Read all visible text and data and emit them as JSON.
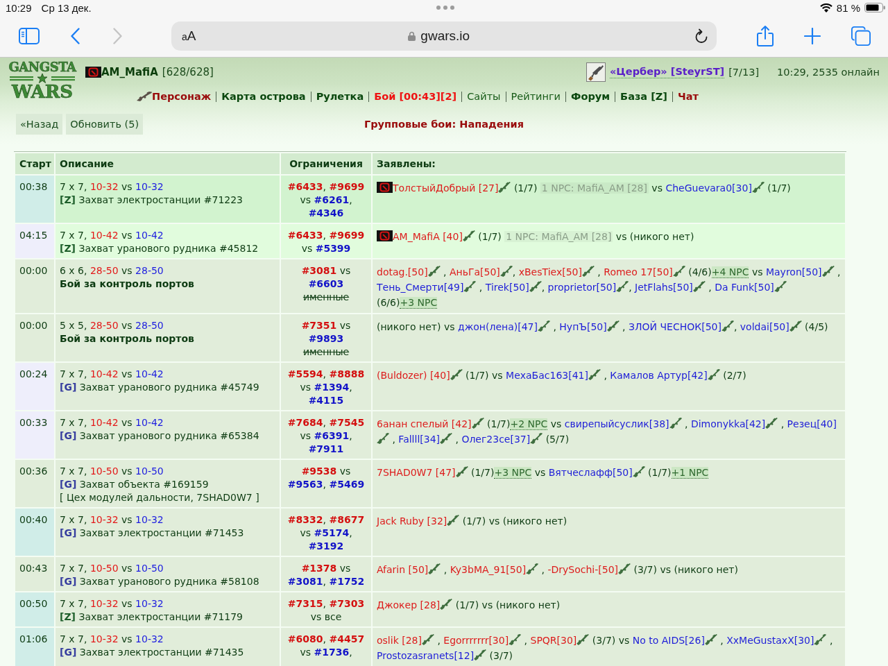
{
  "status_bar": {
    "time": "10:29",
    "date": "Ср 13 дек.",
    "battery": "81 %"
  },
  "browser": {
    "text_size": "aA",
    "address": "gwars.io",
    "back_disabled": false,
    "forward_disabled": true
  },
  "header": {
    "logo": {
      "top": "GANGSTA",
      "bottom": "WARS"
    },
    "player": {
      "name": "AM_MafiA",
      "hp": "[628/628]"
    },
    "weapon": {
      "name": "«Цербер» [SteyrST]",
      "count": "[7/13]"
    },
    "online": "10:29, 2535 онлайн",
    "nav": [
      {
        "label": "Персонаж",
        "kind": "accent"
      },
      {
        "label": "Карта острова",
        "kind": "bold"
      },
      {
        "label": "Рулетка",
        "kind": "bold"
      },
      {
        "label": "Бой [00:43][2]",
        "kind": "alert"
      },
      {
        "label": "Сайты",
        "kind": "plain"
      },
      {
        "label": "Рейтинги",
        "kind": "plain"
      },
      {
        "label": "Форум",
        "kind": "bold"
      },
      {
        "label": "База [Z]",
        "kind": "bold"
      },
      {
        "label": "Чат",
        "kind": "accent"
      }
    ]
  },
  "controls": {
    "buttons": [
      "«Назад",
      "Обновить (5)"
    ]
  },
  "title": "Групповые бои: Нападения",
  "table": {
    "columns": [
      "Старт",
      "Описание",
      "Ограничения",
      "Заявлены:"
    ],
    "rows": [
      {
        "start": "00:38",
        "color": "#d0ede8",
        "kind": "clan",
        "format": [
          {
            "text": "7 x 7, "
          },
          {
            "text": "10-32",
            "color": "#e31919"
          },
          {
            "text": " vs "
          },
          {
            "text": "10-32",
            "color": "#1d1de0"
          }
        ],
        "objective": {
          "tag": {
            "text": "[Z]",
            "color": "#1d5e2a"
          },
          "text": "Захват электростанции #71223",
          "bold": false
        },
        "limits": [
          {
            "text": "#6433",
            "color": "#d40f0f"
          },
          {
            "text": ", "
          },
          {
            "text": "#9699",
            "color": "#d40f0f"
          },
          {
            "text": " vs "
          },
          {
            "text": "#6261",
            "color": "#1212c8"
          },
          {
            "text": ", "
          },
          {
            "text": "#4346",
            "color": "#1212c8"
          }
        ],
        "entrants": [
          {
            "kind": "attacker",
            "name": "ТолстыйДобрый [27]",
            "clan": true,
            "after": " (1/7) "
          },
          {
            "kind": "npc",
            "text": "1 NPC: MafiA_AM [28]"
          },
          {
            "kind": "text",
            "text": " vs "
          },
          {
            "kind": "defender",
            "name": "CheGuevara0[30]",
            "clan": false,
            "after": " (1/7)"
          }
        ]
      },
      {
        "start": "04:15",
        "color": "#eeeefb",
        "kind": "own",
        "format": [
          {
            "text": "7 x 7, "
          },
          {
            "text": "10-42",
            "color": "#e31919"
          },
          {
            "text": " vs "
          },
          {
            "text": "10-42",
            "color": "#1d1de0"
          }
        ],
        "objective": {
          "tag": {
            "text": "[Z]",
            "color": "#1d5e2a"
          },
          "text": "Захват уранового рудника #45812",
          "bold": false
        },
        "limits": [
          {
            "text": "#6433",
            "color": "#d40f0f"
          },
          {
            "text": ", "
          },
          {
            "text": "#9699",
            "color": "#d40f0f"
          },
          {
            "text": " vs "
          },
          {
            "text": "#5399",
            "color": "#1212c8"
          }
        ],
        "entrants": [
          {
            "kind": "attacker",
            "name": "AM_MafiA [40]",
            "clan": true,
            "after": " (1/7) "
          },
          {
            "kind": "npc",
            "text": "1 NPC: MafiA_AM [28]"
          },
          {
            "kind": "text",
            "text": " vs (никого нет)"
          }
        ]
      },
      {
        "start": "00:00",
        "color": "#e1edda",
        "kind": "open",
        "format": [
          {
            "text": "6 x 6, "
          },
          {
            "text": "28-50",
            "color": "#e31919"
          },
          {
            "text": " vs "
          },
          {
            "text": "28-50",
            "color": "#1d1de0"
          }
        ],
        "objective": {
          "text": "Бой за контроль портов",
          "bold": true
        },
        "limits": [
          {
            "text": "#3081",
            "color": "#d40f0f"
          },
          {
            "text": " vs "
          },
          {
            "text": "#6603",
            "color": "#1212c8"
          }
        ],
        "limits_note": {
          "text": "именные",
          "struck": true
        },
        "entrants": [
          {
            "kind": "attacker",
            "name": "dotag.[50]",
            "clan": false,
            "after": " , "
          },
          {
            "kind": "attacker",
            "name": "АньГа[50]",
            "clan": false,
            "after": ", "
          },
          {
            "kind": "attacker",
            "name": "xBesTiex[50]",
            "clan": false,
            "after": " , "
          },
          {
            "kind": "attacker",
            "name": "Romeo 17[50]",
            "clan": false,
            "after": " (4/6)"
          },
          {
            "kind": "bots",
            "text": "+4 NPC"
          },
          {
            "kind": "text",
            "text": " vs "
          },
          {
            "kind": "defender",
            "name": "Mayron[50]",
            "clan": false,
            "after": " , "
          },
          {
            "kind": "defender",
            "name": "Тень_Смерти[49]",
            "clan": false,
            "after": " , "
          },
          {
            "kind": "defender",
            "name": "Tirek[50]",
            "clan": false,
            "after": ", "
          },
          {
            "kind": "defender",
            "name": "proprietor[50]",
            "clan": false,
            "after": ", "
          },
          {
            "kind": "defender",
            "name": "JetFlahs[50]",
            "clan": false,
            "after": " , "
          },
          {
            "kind": "defender",
            "name": "Da Funk[50]",
            "clan": false,
            "after": " (6/6)"
          },
          {
            "kind": "bots",
            "text": "+3 NPC"
          }
        ]
      },
      {
        "start": "00:00",
        "color": "#e1edda",
        "kind": "open",
        "format": [
          {
            "text": "5 x 5, "
          },
          {
            "text": "28-50",
            "color": "#e31919"
          },
          {
            "text": " vs "
          },
          {
            "text": "28-50",
            "color": "#1d1de0"
          }
        ],
        "objective": {
          "text": "Бой за контроль портов",
          "bold": true
        },
        "limits": [
          {
            "text": "#7351",
            "color": "#d40f0f"
          },
          {
            "text": " vs "
          },
          {
            "text": "#9893",
            "color": "#1212c8"
          }
        ],
        "limits_note": {
          "text": "именные",
          "struck": true
        },
        "entrants": [
          {
            "kind": "text",
            "text": "(никого нет) vs "
          },
          {
            "kind": "defender",
            "name": "джон(лена)[47]",
            "clan": false,
            "after": " , "
          },
          {
            "kind": "defender",
            "name": "НупЪ[50]",
            "clan": false,
            "after": " , "
          },
          {
            "kind": "defender",
            "name": "ЗЛОЙ ЧЕСНОК[50]",
            "clan": false,
            "after": ", "
          },
          {
            "kind": "defender",
            "name": "voldai[50]",
            "clan": false,
            "after": " (4/5)"
          }
        ]
      },
      {
        "start": "00:24",
        "color": "#eeeefb",
        "kind": "open",
        "format": [
          {
            "text": "7 x 7, "
          },
          {
            "text": "10-42",
            "color": "#e31919"
          },
          {
            "text": " vs "
          },
          {
            "text": "10-42",
            "color": "#1d1de0"
          }
        ],
        "objective": {
          "tag": {
            "text": "[G]",
            "color": "#353c9e"
          },
          "text": "Захват уранового рудника #45749",
          "bold": false
        },
        "limits": [
          {
            "text": "#5594",
            "color": "#d40f0f"
          },
          {
            "text": ", "
          },
          {
            "text": "#8888",
            "color": "#d40f0f"
          },
          {
            "text": " vs "
          },
          {
            "text": "#1394",
            "color": "#1212c8"
          },
          {
            "text": ", "
          },
          {
            "text": "#4115",
            "color": "#1212c8"
          }
        ],
        "entrants": [
          {
            "kind": "attacker",
            "name": "(Buldozer) [40]",
            "clan": false,
            "after": " (1/7)"
          },
          {
            "kind": "text",
            "text": " vs "
          },
          {
            "kind": "defender",
            "name": "МехаБас163[41]",
            "clan": false,
            "after": " , "
          },
          {
            "kind": "defender",
            "name": "Камалов Артур[42]",
            "clan": false,
            "after": " (2/7)"
          }
        ]
      },
      {
        "start": "00:33",
        "color": "#eeeefb",
        "kind": "open",
        "format": [
          {
            "text": "7 x 7, "
          },
          {
            "text": "10-42",
            "color": "#e31919"
          },
          {
            "text": " vs "
          },
          {
            "text": "10-42",
            "color": "#1d1de0"
          }
        ],
        "objective": {
          "tag": {
            "text": "[G]",
            "color": "#353c9e"
          },
          "text": "Захват уранового рудника #65384",
          "bold": false
        },
        "limits": [
          {
            "text": "#7684",
            "color": "#d40f0f"
          },
          {
            "text": ", "
          },
          {
            "text": "#7545",
            "color": "#d40f0f"
          },
          {
            "text": " vs "
          },
          {
            "text": "#6391",
            "color": "#1212c8"
          },
          {
            "text": ", "
          },
          {
            "text": "#7911",
            "color": "#1212c8"
          }
        ],
        "entrants": [
          {
            "kind": "attacker",
            "name": "6анан спелый [42]",
            "clan": false,
            "after": " (1/7)"
          },
          {
            "kind": "bots",
            "text": "+2 NPC"
          },
          {
            "kind": "text",
            "text": " vs "
          },
          {
            "kind": "defender",
            "name": "свирепыйсуслик[38]",
            "clan": false,
            "after": " , "
          },
          {
            "kind": "defender",
            "name": "Dimonykka[42]",
            "clan": false,
            "after": " , "
          },
          {
            "kind": "defender",
            "name": "Резец[40]",
            "clan": false,
            "after": " , "
          },
          {
            "kind": "defender",
            "name": "Fallll[34]",
            "clan": false,
            "after": " , "
          },
          {
            "kind": "defender",
            "name": "Олег23се[37]",
            "clan": false,
            "after": " (5/7)"
          }
        ]
      },
      {
        "start": "00:36",
        "color": "#e1edda",
        "kind": "open",
        "format": [
          {
            "text": "7 x 7, "
          },
          {
            "text": "10-50",
            "color": "#e31919"
          },
          {
            "text": " vs "
          },
          {
            "text": "10-50",
            "color": "#1d1de0"
          }
        ],
        "objective": {
          "tag": {
            "text": "[G]",
            "color": "#353c9e"
          },
          "text": "Захват объекта #169159",
          "bold": false
        },
        "note": "[ Цех модулей дальности, 7SHAD0W7 ]",
        "limits": [
          {
            "text": "#9538",
            "color": "#d40f0f"
          },
          {
            "text": " vs "
          },
          {
            "text": "#9563",
            "color": "#1212c8"
          },
          {
            "text": ", "
          },
          {
            "text": "#5469",
            "color": "#1212c8"
          }
        ],
        "entrants": [
          {
            "kind": "attacker",
            "name": "7SHAD0W7 [47]",
            "clan": false,
            "after": " (1/7)"
          },
          {
            "kind": "bots",
            "text": "+3 NPC"
          },
          {
            "kind": "text",
            "text": " vs "
          },
          {
            "kind": "defender",
            "name": "Вятчеслафф[50]",
            "clan": false,
            "after": " (1/7)"
          },
          {
            "kind": "bots",
            "text": "+1 NPC"
          }
        ]
      },
      {
        "start": "00:40",
        "color": "#d0ede8",
        "kind": "open",
        "format": [
          {
            "text": "7 x 7, "
          },
          {
            "text": "10-32",
            "color": "#e31919"
          },
          {
            "text": " vs "
          },
          {
            "text": "10-32",
            "color": "#1d1de0"
          }
        ],
        "objective": {
          "tag": {
            "text": "[G]",
            "color": "#353c9e"
          },
          "text": "Захват электростанции #71453",
          "bold": false
        },
        "limits": [
          {
            "text": "#8332",
            "color": "#d40f0f"
          },
          {
            "text": ", "
          },
          {
            "text": "#8677",
            "color": "#d40f0f"
          },
          {
            "text": " vs "
          },
          {
            "text": "#5174",
            "color": "#1212c8"
          },
          {
            "text": ", "
          },
          {
            "text": "#3192",
            "color": "#1212c8"
          }
        ],
        "entrants": [
          {
            "kind": "attacker",
            "name": "Jack Ruby [32]",
            "clan": false,
            "after": " (1/7)"
          },
          {
            "kind": "text",
            "text": " vs (никого нет)"
          }
        ]
      },
      {
        "start": "00:43",
        "color": "#e1edda",
        "kind": "open",
        "format": [
          {
            "text": "7 x 7, "
          },
          {
            "text": "10-50",
            "color": "#e31919"
          },
          {
            "text": " vs "
          },
          {
            "text": "10-50",
            "color": "#1d1de0"
          }
        ],
        "objective": {
          "tag": {
            "text": "[G]",
            "color": "#353c9e"
          },
          "text": "Захват уранового рудника #58108",
          "bold": false
        },
        "limits": [
          {
            "text": "#1378",
            "color": "#d40f0f"
          },
          {
            "text": " vs "
          },
          {
            "text": "#3081",
            "color": "#1212c8"
          },
          {
            "text": ", "
          },
          {
            "text": "#1752",
            "color": "#1212c8"
          }
        ],
        "entrants": [
          {
            "kind": "attacker",
            "name": "Afarin [50]",
            "clan": false,
            "after": " , "
          },
          {
            "kind": "attacker",
            "name": "Ky3bMA_91[50]",
            "clan": false,
            "after": " , "
          },
          {
            "kind": "attacker",
            "name": "-DrySochi-[50]",
            "clan": false,
            "after": " (3/7)"
          },
          {
            "kind": "text",
            "text": " vs (никого нет)"
          }
        ]
      },
      {
        "start": "00:50",
        "color": "#d0ede8",
        "kind": "open",
        "format": [
          {
            "text": "7 x 7, "
          },
          {
            "text": "10-32",
            "color": "#e31919"
          },
          {
            "text": " vs "
          },
          {
            "text": "10-32",
            "color": "#1d1de0"
          }
        ],
        "objective": {
          "tag": {
            "text": "[Z]",
            "color": "#1d5e2a"
          },
          "text": "Захват электростанции #71179",
          "bold": false
        },
        "limits": [
          {
            "text": "#7315",
            "color": "#d40f0f"
          },
          {
            "text": ", "
          },
          {
            "text": "#7303",
            "color": "#d40f0f"
          },
          {
            "text": " vs все"
          }
        ],
        "entrants": [
          {
            "kind": "attacker",
            "name": "Джокер [28]",
            "clan": false,
            "after": " (1/7)"
          },
          {
            "kind": "text",
            "text": " vs (никого нет)"
          }
        ]
      },
      {
        "start": "01:06",
        "color": "#d0ede8",
        "kind": "open",
        "format": [
          {
            "text": "7 x 7, "
          },
          {
            "text": "10-32",
            "color": "#e31919"
          },
          {
            "text": " vs "
          },
          {
            "text": "10-32",
            "color": "#1d1de0"
          }
        ],
        "objective": {
          "tag": {
            "text": "[G]",
            "color": "#353c9e"
          },
          "text": "Захват электростанции #71435",
          "bold": false
        },
        "limits": [
          {
            "text": "#6080",
            "color": "#d40f0f"
          },
          {
            "text": ", "
          },
          {
            "text": "#4457",
            "color": "#d40f0f"
          },
          {
            "text": " vs "
          },
          {
            "text": "#1736",
            "color": "#1212c8"
          },
          {
            "text": ","
          }
        ],
        "entrants": [
          {
            "kind": "attacker",
            "name": "oslik [28]",
            "clan": false,
            "after": " , "
          },
          {
            "kind": "attacker",
            "name": "Egorrrrrrr[30]",
            "clan": false,
            "after": " , "
          },
          {
            "kind": "attacker",
            "name": "SPQR[30]",
            "clan": false,
            "after": " (3/7)"
          },
          {
            "kind": "text",
            "text": " vs "
          },
          {
            "kind": "defender",
            "name": "No to AIDS[26]",
            "clan": false,
            "after": " , "
          },
          {
            "kind": "defender",
            "name": "XxMeGustaxX[30]",
            "clan": false,
            "after": " , "
          },
          {
            "kind": "defender",
            "name": "Prostozasranets[12]",
            "clan": false,
            "after": " (3/7)"
          }
        ]
      }
    ]
  }
}
